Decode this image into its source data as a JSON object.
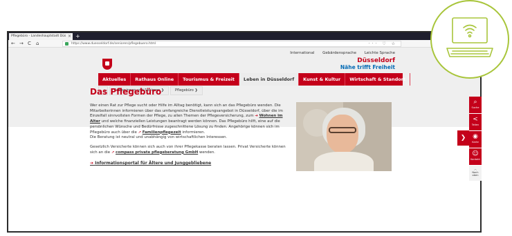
{
  "browser": {
    "tab_title": "Pflegebüro - Landeshauptstadt Düs",
    "tab_close": "×",
    "new_tab": "+",
    "back": "←",
    "forward": "→",
    "reload": "C",
    "home": "⌂",
    "url": "https://www.duesseldorf.de/senioren/pflegebuero.html",
    "toolbar_icons": "··· ♡ ☆"
  },
  "site": {
    "top_links": [
      "International",
      "Gebärdensprache",
      "Leichte Sprache"
    ],
    "brand_city": "Düsseldorf",
    "brand_claim": "Nähe trifft Freiheit",
    "menu": [
      "Aktuelles",
      "Rathaus Online",
      "Tourismus & Freizeit",
      "Leben in Düsseldorf",
      "Kunst & Kultur",
      "Wirtschaft & Standort"
    ],
    "breadcrumbs": [
      "Senior:innen und Senioren ❯",
      "Pflegebüro ❯"
    ]
  },
  "content": {
    "heading": "Das Pflegebüro",
    "p1_a": "Wer einen Rat zur Pflege sucht oder Hilfe im Alltag benötigt, kann sich an das Pflegebüro wenden. Die Mitarbeiterinnen informieren über das umfangreiche Dienstleistungsangebot in Düsseldorf, über die im Einzelfall sinnvollsten Formen der Pflege, zu allen Themen der Pflegeversicherung, zum",
    "link_wohnen": "Wohnen im Alter",
    "p1_b": "und welche finanziellen Leistungen beantragt werden können. Das Pflegebüro hilft, eine auf die persönlichen Wünsche und Bedürfnisse zugeschnittene Lösung zu finden. Angehörige können sich im Pflegebüro auch über die",
    "link_familie": "Familienpflegezeit",
    "p1_c": "informieren.",
    "p1_d": "Die Beratung ist neutral und unabhängig von wirtschaftlichen Interessen.",
    "p2_a": "Gesetzlich Versicherte können sich auch von ihrer Pflegekasse beraten lassen. Privat Versicherte können sich an die",
    "link_compass": "compass private pflegeberatung GmbH",
    "p2_b": "wenden.",
    "foot_link": "Informationsportal für Ältere und Junggebliebene"
  },
  "sidebar": {
    "toggle": "❯",
    "items": [
      {
        "icon": "⌕",
        "label": "Suche"
      },
      {
        "icon": "<",
        "label": "Teilen"
      },
      {
        "icon": "◉",
        "label": "Karte"
      },
      {
        "icon": "☺",
        "label": "Kontakt"
      }
    ],
    "top_icon": "︿",
    "top_label": "Nach oben"
  },
  "colors": {
    "brand_red": "#c4001a",
    "brand_blue": "#0069b4",
    "badge_green": "#a8c53a"
  }
}
